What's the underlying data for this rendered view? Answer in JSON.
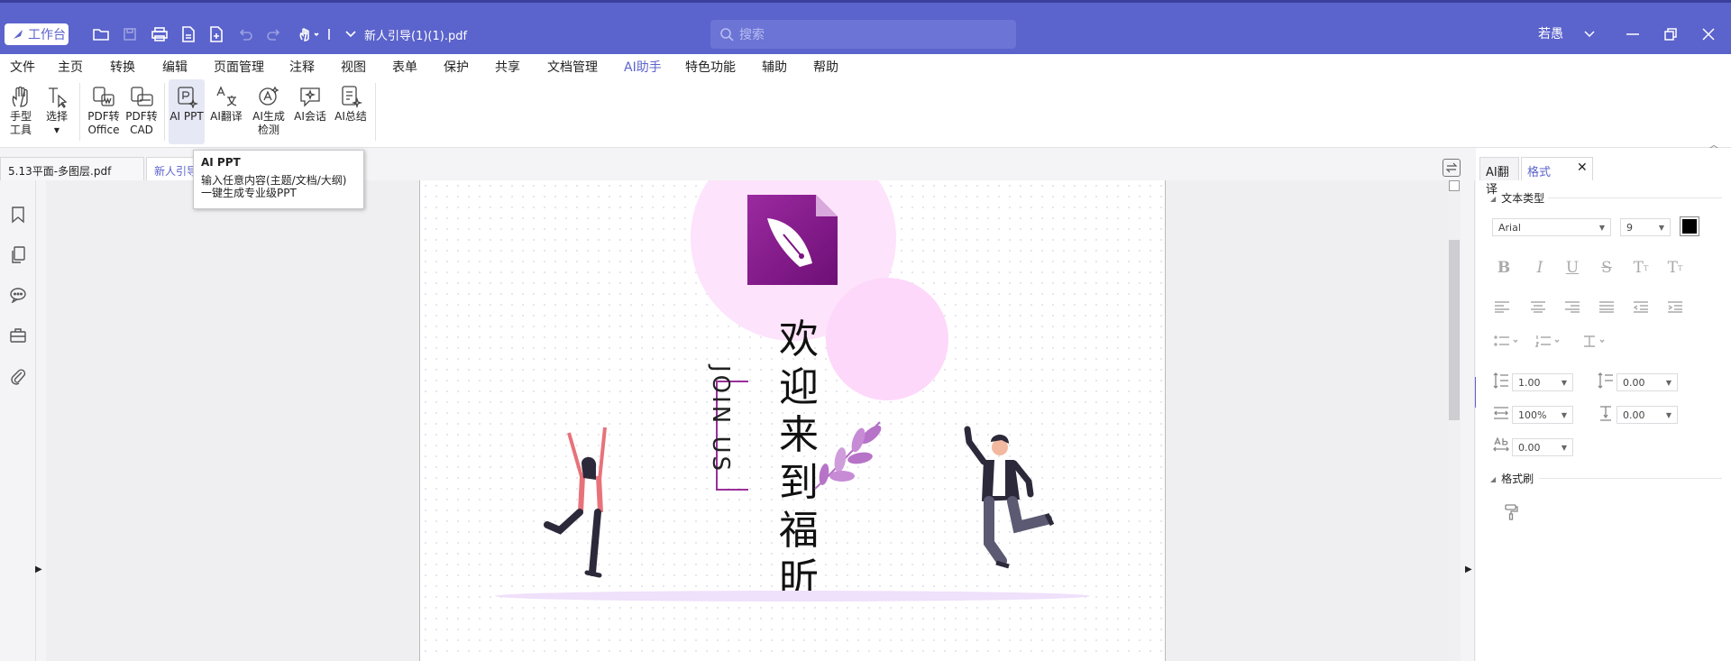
{
  "titlebar": {
    "workbench_label": "工作台",
    "document_title": "新人引导(1)(1).pdf",
    "search_placeholder": "搜索",
    "user_name": "若愚"
  },
  "menu": [
    "文件",
    "主页",
    "转换",
    "编辑",
    "页面管理",
    "注释",
    "视图",
    "表单",
    "保护",
    "共享",
    "文档管理",
    "AI助手",
    "特色功能",
    "辅助",
    "帮助"
  ],
  "menu_active": "AI助手",
  "ribbon": {
    "hand_tool": [
      "手型",
      "工具"
    ],
    "select": [
      "选择"
    ],
    "pdf_to_office": [
      "PDF转",
      "Office"
    ],
    "pdf_to_cad": [
      "PDF转",
      "CAD"
    ],
    "ai_ppt": [
      "AI PPT"
    ],
    "ai_translate": [
      "AI翻译"
    ],
    "ai_detect": [
      "AI生成",
      "检测"
    ],
    "ai_chat": [
      "AI会话"
    ],
    "ai_summary": [
      "AI总结"
    ]
  },
  "tabs": {
    "doc_tab_1": "5.13平面-多图层.pdf",
    "doc_tab_2": "新人引导"
  },
  "tooltip": {
    "title": "AI PPT",
    "line1": "输入任意内容(主题/文档/大纲)",
    "line2": "一键生成专业级PPT"
  },
  "page": {
    "welcome_text": "欢迎来到福昕",
    "join_text": "JOIN US"
  },
  "panel": {
    "tab_translate": "AI翻译",
    "tab_format": "格式",
    "close": "✕",
    "section_text_type": "文本类型",
    "font_name": "Arial",
    "font_size": "9",
    "line_spacing": "1.00",
    "para_spacing": "0.00",
    "scale": "100%",
    "char_offset": "0.00",
    "char_spacing": "0.00",
    "section_format_painter": "格式刷"
  },
  "colors": {
    "brand": "#5b63cc",
    "accent_logo": "#8a1a8e",
    "text_color_swatch": "#000000"
  }
}
